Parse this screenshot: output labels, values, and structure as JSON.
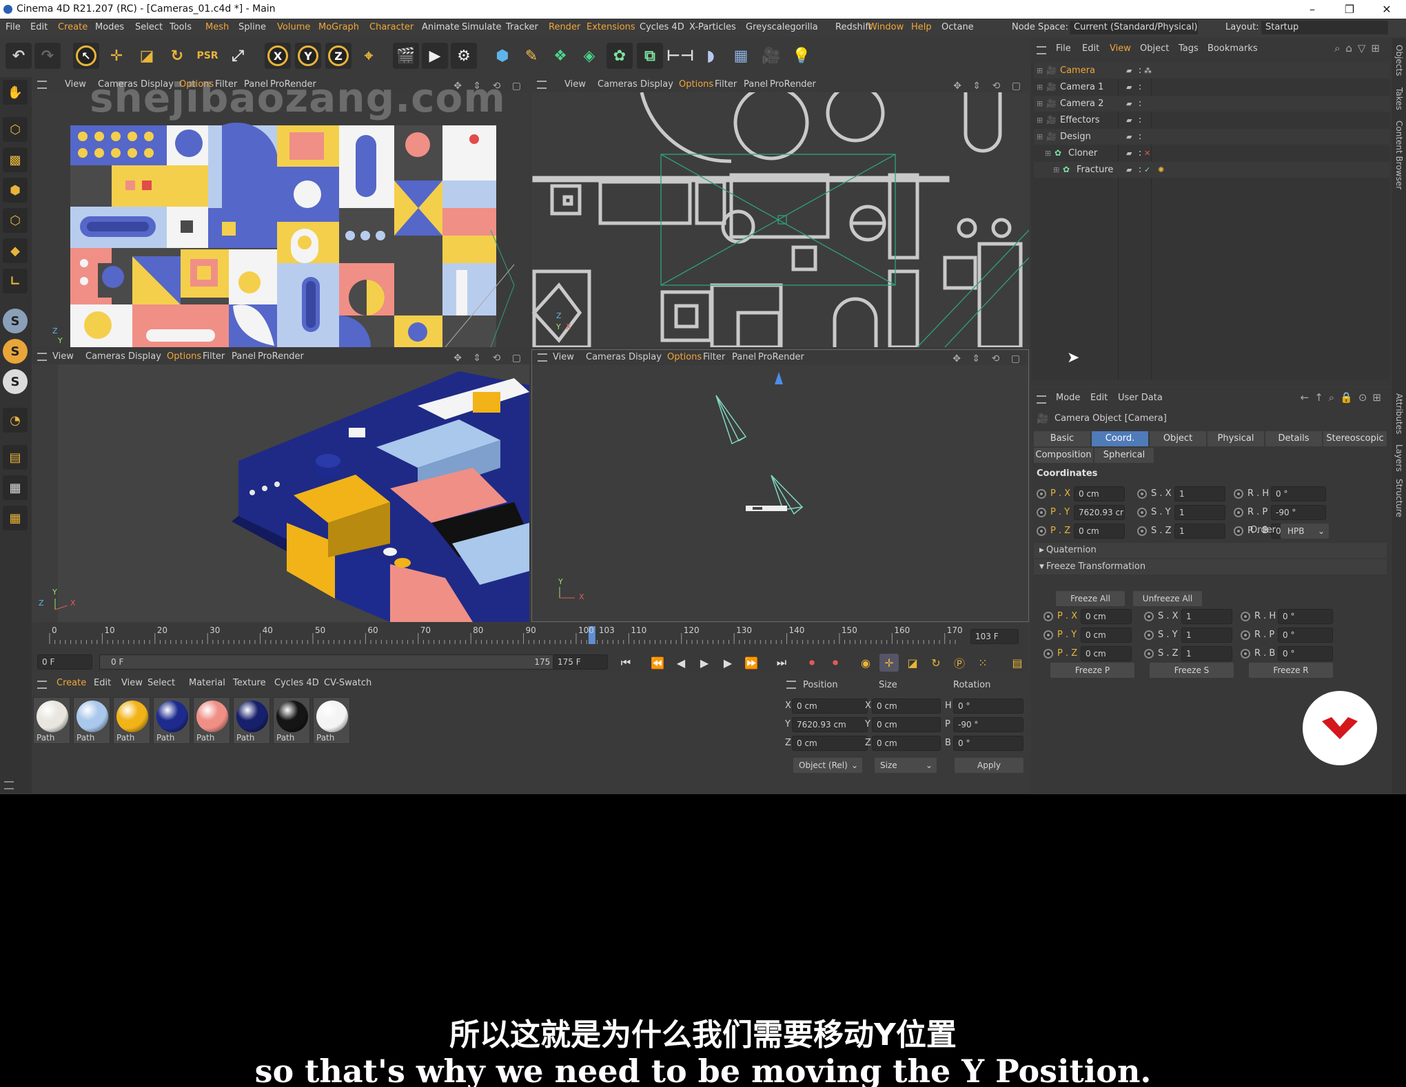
{
  "window": {
    "title": "Cinema 4D R21.207 (RC) - [Cameras_01.c4d *] - Main",
    "controls": [
      "–",
      "❐",
      "✕"
    ]
  },
  "menubar": {
    "items": [
      {
        "label": "File",
        "accent": false
      },
      {
        "label": "Edit",
        "accent": false
      },
      {
        "label": "Create",
        "accent": true
      },
      {
        "label": "Modes",
        "accent": false
      },
      {
        "label": "Select",
        "accent": false
      },
      {
        "label": "Tools",
        "accent": false
      },
      {
        "label": "Mesh",
        "accent": true
      },
      {
        "label": "Spline",
        "accent": false
      },
      {
        "label": "Volume",
        "accent": true
      },
      {
        "label": "MoGraph",
        "accent": true
      },
      {
        "label": "Character",
        "accent": true
      },
      {
        "label": "Animate",
        "accent": false
      },
      {
        "label": "Simulate",
        "accent": false
      },
      {
        "label": "Tracker",
        "accent": false
      },
      {
        "label": "Render",
        "accent": true
      },
      {
        "label": "Extensions",
        "accent": true
      },
      {
        "label": "Cycles 4D",
        "accent": false
      },
      {
        "label": "X-Particles",
        "accent": false
      },
      {
        "label": "Greyscalegorilla",
        "accent": false
      },
      {
        "label": "Redshift",
        "accent": false
      },
      {
        "label": "Window",
        "accent": true
      },
      {
        "label": "Help",
        "accent": true
      },
      {
        "label": "Octane",
        "accent": false
      }
    ],
    "node_space_label": "Node Space:",
    "node_space_value": "Current (Standard/Physical)",
    "layout_label": "Layout:",
    "layout_value": "Startup"
  },
  "viewports": {
    "top_left": {
      "items": [
        "View",
        "Cameras",
        "Display",
        "Options",
        "Filter",
        "Panel",
        "ProRender"
      ]
    },
    "top_right": {
      "items": [
        "View",
        "Cameras",
        "Display",
        "Options",
        "Filter",
        "Panel",
        "ProRender"
      ]
    },
    "bottom_left": {
      "items": [
        "View",
        "Cameras",
        "Display",
        "Options",
        "Filter",
        "Panel",
        "ProRender"
      ]
    },
    "bottom_right": {
      "items": [
        "View",
        "Cameras",
        "Display",
        "Options",
        "Filter",
        "Panel",
        "ProRender"
      ]
    },
    "highlight": "Options",
    "nav_icons": "✥ ⇕ ⟲ ▢"
  },
  "watermark": "shejibaozang.com",
  "timeline": {
    "ticks": [
      "0",
      "10",
      "20",
      "30",
      "40",
      "50",
      "60",
      "70",
      "80",
      "90",
      "100",
      "103",
      "110",
      "120",
      "130",
      "140",
      "150",
      "160",
      "170"
    ],
    "current_frame": 103,
    "max_frame": 175,
    "current_frame_field": "103 F",
    "start_field": "0 F",
    "range_start": "0 F",
    "range_end": "175 F",
    "end_field": "175 F"
  },
  "materials": {
    "menu": [
      {
        "label": "Create",
        "accent": true
      },
      {
        "label": "Edit",
        "accent": false
      },
      {
        "label": "View",
        "accent": false
      },
      {
        "label": "Select",
        "accent": false
      },
      {
        "label": "Material",
        "accent": false
      },
      {
        "label": "Texture",
        "accent": false
      },
      {
        "label": "Cycles 4D",
        "accent": false
      },
      {
        "label": "CV-Swatch",
        "accent": false
      }
    ],
    "items": [
      {
        "label": "Path",
        "color": "#e8e6df"
      },
      {
        "label": "Path",
        "color": "#a9c8ec"
      },
      {
        "label": "Path",
        "color": "#f1b318"
      },
      {
        "label": "Path",
        "color": "#1d2b8f"
      },
      {
        "label": "Path",
        "color": "#f08f86"
      },
      {
        "label": "Path",
        "color": "#17206b"
      },
      {
        "label": "Path",
        "color": "#151515"
      },
      {
        "label": "Path",
        "color": "#f4f4f4"
      }
    ]
  },
  "coord_manager": {
    "headers": [
      "Position",
      "Size",
      "Rotation"
    ],
    "rows": [
      {
        "axis": "X",
        "pos": "0 cm",
        "size_axis": "X",
        "size": "0 cm",
        "rot_axis": "H",
        "rot": "0 °"
      },
      {
        "axis": "Y",
        "pos": "7620.93 cm",
        "size_axis": "Y",
        "size": "0 cm",
        "rot_axis": "P",
        "rot": "-90 °"
      },
      {
        "axis": "Z",
        "pos": "0 cm",
        "size_axis": "Z",
        "size": "0 cm",
        "rot_axis": "B",
        "rot": "0 °"
      }
    ],
    "mode": "Object (Rel)",
    "size_mode": "Size",
    "apply": "Apply"
  },
  "object_manager": {
    "menu": [
      "File",
      "Edit",
      "View",
      "Object",
      "Tags",
      "Bookmarks"
    ],
    "menu_accent": "View",
    "objects": [
      {
        "name": "Camera",
        "indent": 0,
        "selected": true
      },
      {
        "name": "Camera 1",
        "indent": 0,
        "selected": false
      },
      {
        "name": "Camera 2",
        "indent": 0,
        "selected": false
      },
      {
        "name": "Effectors",
        "indent": 0,
        "selected": false
      },
      {
        "name": "Design",
        "indent": 0,
        "selected": false
      },
      {
        "name": "Cloner",
        "indent": 1,
        "selected": false
      },
      {
        "name": "Fracture",
        "indent": 2,
        "selected": false
      }
    ]
  },
  "attributes": {
    "menu": [
      "Mode",
      "Edit",
      "User Data"
    ],
    "object_title": "Camera Object [Camera]",
    "tabs": [
      "Basic",
      "Coord.",
      "Object",
      "Physical",
      "Details",
      "Stereoscopic"
    ],
    "tabs_row2": [
      "Composition",
      "Spherical"
    ],
    "selected_tab": "Coord.",
    "section": "Coordinates",
    "coords": [
      {
        "p_label": "P . X",
        "p": "0 cm",
        "s_label": "S . X",
        "s": "1",
        "r_label": "R . H",
        "r": "0 °"
      },
      {
        "p_label": "P . Y",
        "p": "7620.93 cr",
        "s_label": "S . Y",
        "s": "1",
        "r_label": "R . P",
        "r": "-90 °"
      },
      {
        "p_label": "P . Z",
        "p": "0 cm",
        "s_label": "S . Z",
        "s": "1",
        "r_label": "R . B",
        "r": "0 °"
      }
    ],
    "order_label": "Order",
    "order_value": "HPB",
    "quaternion": "Quaternion",
    "freeze_section": "Freeze Transformation",
    "freeze_all": "Freeze All",
    "unfreeze_all": "Unfreeze All",
    "freeze_coords": [
      {
        "p_label": "P . X",
        "p": "0 cm",
        "s_label": "S . X",
        "s": "1",
        "r_label": "R . H",
        "r": "0 °"
      },
      {
        "p_label": "P . Y",
        "p": "0 cm",
        "s_label": "S . Y",
        "s": "1",
        "r_label": "R . P",
        "r": "0 °"
      },
      {
        "p_label": "P . Z",
        "p": "0 cm",
        "s_label": "S . Z",
        "s": "1",
        "r_label": "R . B",
        "r": "0 °"
      }
    ],
    "freeze_p": "Freeze P",
    "freeze_s": "Freeze S",
    "freeze_r": "Freeze R"
  },
  "right_strip": {
    "top": [
      "Objects",
      "Takes",
      "Content Browser"
    ],
    "bottom": [
      "Attributes",
      "Layers",
      "Structure"
    ]
  },
  "subtitles": {
    "cn": "所以这就是为什么我们需要移动Y位置",
    "en": "so that's why we need to be moving the Y Position."
  },
  "colors": {
    "accent_orange": "#f0a63a",
    "selection_blue": "#4f7bb8",
    "object_name_orange": "#f0a63a",
    "logo_red": "#d4171c"
  }
}
